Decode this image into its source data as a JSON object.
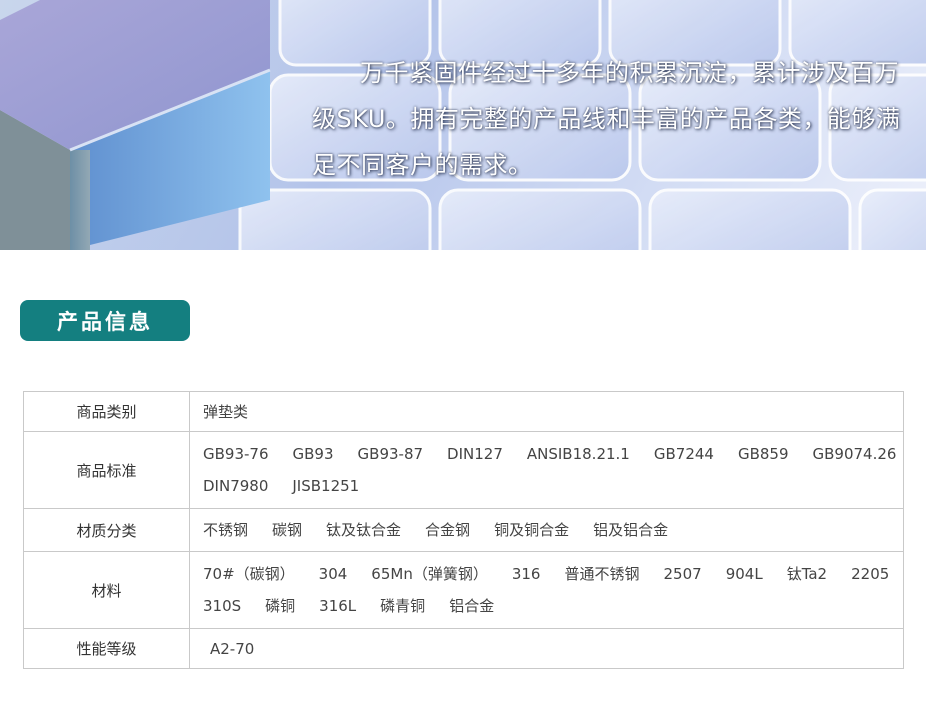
{
  "hero": {
    "text": "万千紧固件经过十多年的积累沉淀，累计涉及百万级SKU。拥有完整的产品线和丰富的产品各类，能够满足不同客户的需求。"
  },
  "section": {
    "title": "产品信息"
  },
  "table": {
    "rows": [
      {
        "label": "商品类别",
        "values": [
          "弹垫类"
        ]
      },
      {
        "label": "商品标准",
        "values": [
          "GB93-76",
          "GB93",
          "GB93-87",
          "DIN127",
          "ANSIB18.21.1",
          "GB7244",
          "GB859",
          "GB9074.26",
          "DIN7980",
          "JISB1251"
        ]
      },
      {
        "label": "材质分类",
        "values": [
          "不锈钢",
          "碳钢",
          "钛及钛合金",
          "合金钢",
          "铜及铜合金",
          "铝及铝合金"
        ]
      },
      {
        "label": "材料",
        "values": [
          "70#（碳钢）",
          "304",
          "65Mn（弹簧钢）",
          "316",
          "普通不锈钢",
          "2507",
          "904L",
          "钛Ta2",
          "2205",
          "310S",
          "磷铜",
          "316L",
          "磷青铜",
          "铝合金"
        ]
      },
      {
        "label": "性能等级",
        "values": [
          "A2-70"
        ]
      }
    ]
  },
  "colors": {
    "badge": "#147f80",
    "border": "#c9c9c9"
  }
}
